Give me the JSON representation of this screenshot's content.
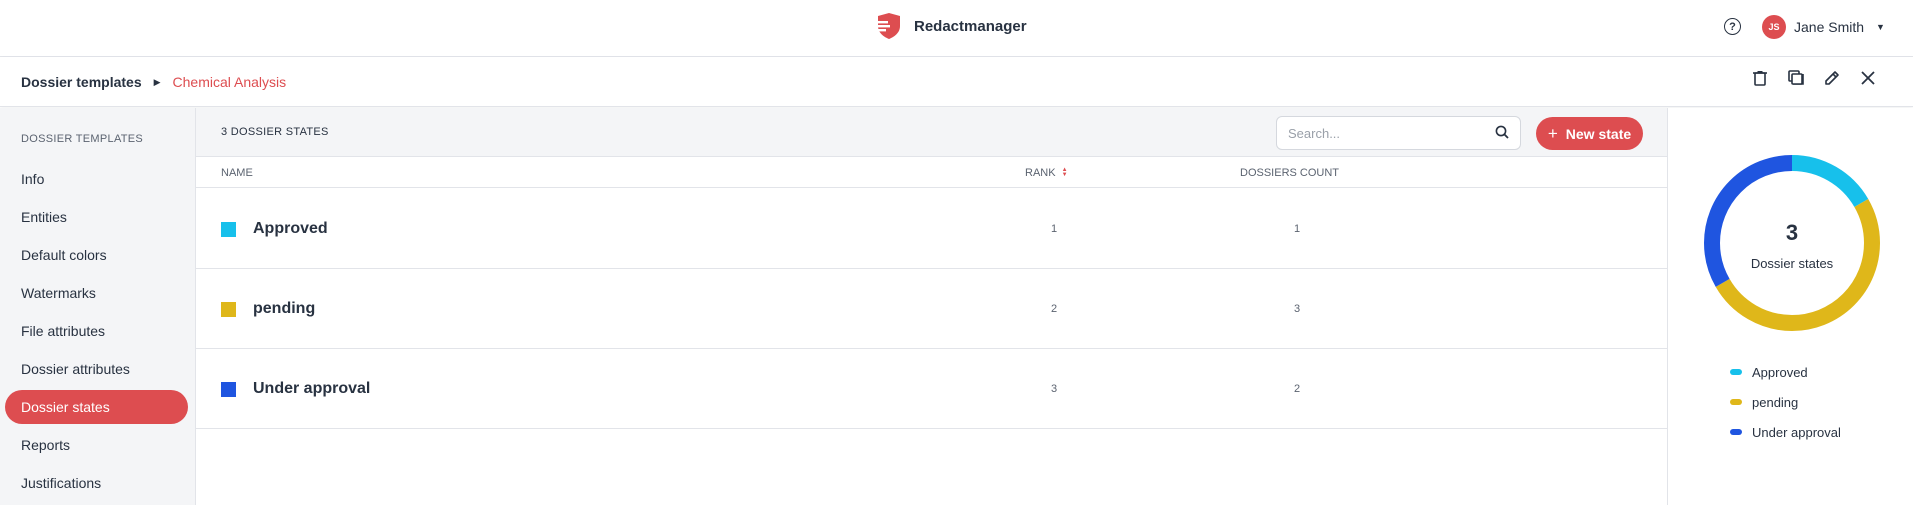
{
  "header": {
    "app_name": "Redactmanager",
    "help_icon": "help-circle-icon",
    "user": {
      "initials": "JS",
      "name": "Jane Smith"
    }
  },
  "breadcrumb": {
    "root": "Dossier templates",
    "current": "Chemical Analysis",
    "actions": [
      "delete-icon",
      "copy-icon",
      "edit-icon",
      "close-icon"
    ]
  },
  "sidebar": {
    "title": "DOSSIER TEMPLATES",
    "items": [
      {
        "label": "Info"
      },
      {
        "label": "Entities"
      },
      {
        "label": "Default colors"
      },
      {
        "label": "Watermarks"
      },
      {
        "label": "File attributes"
      },
      {
        "label": "Dossier attributes"
      },
      {
        "label": "Dossier states",
        "active": true
      },
      {
        "label": "Reports"
      },
      {
        "label": "Justifications"
      }
    ]
  },
  "list": {
    "count_label": "3 DOSSIER STATES",
    "search_placeholder": "Search...",
    "new_button_label": "New state",
    "columns": {
      "name": "NAME",
      "rank": "RANK",
      "count": "DOSSIERS COUNT"
    },
    "rows": [
      {
        "name": "Approved",
        "color": "#17c0eb",
        "rank": "1",
        "count": "1"
      },
      {
        "name": "pending",
        "color": "#dfb71a",
        "rank": "2",
        "count": "3"
      },
      {
        "name": "Under approval",
        "color": "#1f55e0",
        "rank": "3",
        "count": "2"
      }
    ]
  },
  "summary": {
    "total": "3",
    "label": "Dossier states",
    "legend": [
      {
        "name": "Approved",
        "color": "#17c0eb",
        "value": 1
      },
      {
        "name": "pending",
        "color": "#dfb71a",
        "value": 3
      },
      {
        "name": "Under approval",
        "color": "#1f55e0",
        "value": 2
      }
    ]
  },
  "colors": {
    "accent": "#dd4d50",
    "text": "#283241"
  }
}
